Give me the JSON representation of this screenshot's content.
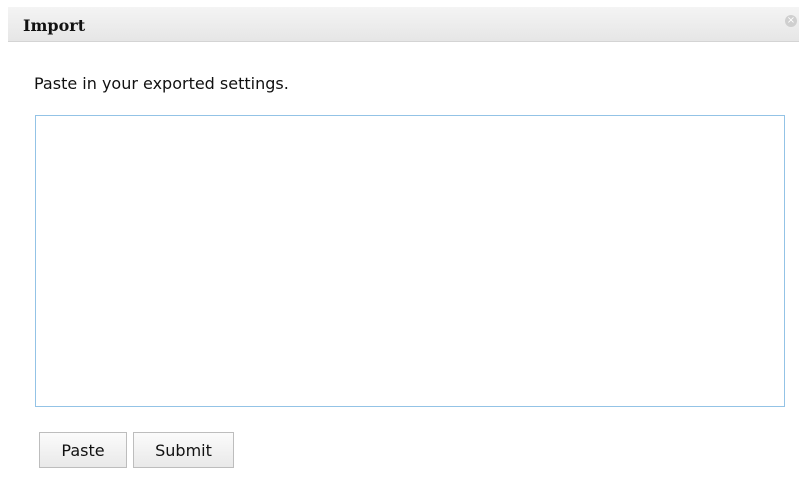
{
  "dialog": {
    "title": "Import",
    "close_icon": "close-icon",
    "close_glyph": "×",
    "instructions": "Paste in your exported settings.",
    "textarea_value": "",
    "buttons": {
      "paste_label": "Paste",
      "submit_label": "Submit"
    }
  },
  "colors": {
    "titlebar_bg": "#e9e9e9",
    "textarea_border": "#93c3e6"
  }
}
